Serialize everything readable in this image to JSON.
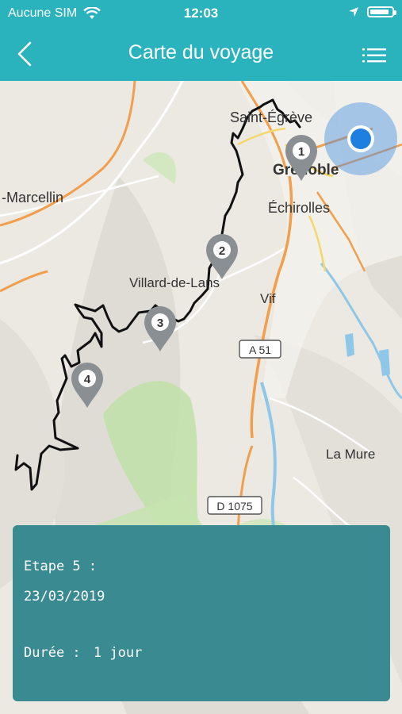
{
  "status_bar": {
    "carrier": "Aucune SIM",
    "time": "12:03",
    "battery_level": 0.9
  },
  "nav": {
    "title": "Carte du voyage",
    "back_icon": "chevron-left-icon",
    "menu_icon": "list-icon"
  },
  "map": {
    "places": {
      "saint_egreve": "Saint-Égrève",
      "grenoble": "Grenoble",
      "marcellin": "-Marcellin",
      "echirolles": "Échirolles",
      "villard": "Villard-de-Lans",
      "vif": "Vif",
      "la_mure": "La Mure"
    },
    "roads": {
      "a51": "A 51",
      "d1075": "D 1075"
    },
    "markers": [
      "1",
      "2",
      "3",
      "4"
    ]
  },
  "stage": {
    "title": "Etape 5 :",
    "date": "23/03/2019",
    "duration_label": "Durée :",
    "duration_value": "1 jour"
  },
  "colors": {
    "header": "#2ab3bd",
    "panel": "#3a8a91",
    "marker": "#8a8f94",
    "location": "#1f7fe0"
  }
}
